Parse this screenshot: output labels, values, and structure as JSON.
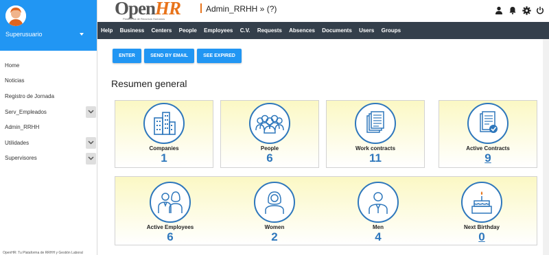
{
  "user": {
    "name": "Superusuario"
  },
  "sidebar": {
    "items": [
      {
        "label": "Home",
        "expandable": false
      },
      {
        "label": "Noticias",
        "expandable": false
      },
      {
        "label": "Registro de Jornada",
        "expandable": false
      },
      {
        "label": "Serv_Empleados",
        "expandable": true
      },
      {
        "label": "Admin_RRHH",
        "expandable": false
      },
      {
        "label": "Utilidades",
        "expandable": true
      },
      {
        "label": "Supervisores",
        "expandable": true
      }
    ],
    "footer": "OpenHR: Tu Plataforma de RRHH y Gestión Laboral"
  },
  "brand": {
    "open": "Open",
    "hr": "HR",
    "subtitle": "Plataforma de Recursos Humanos"
  },
  "header": {
    "breadcrumb": "Admin_RRHH » (?)"
  },
  "top_icons": [
    "user-icon",
    "bell-icon",
    "gear-icon",
    "power-icon"
  ],
  "nav": [
    "Help",
    "Business",
    "Centers",
    "People",
    "Employees",
    "C.V.",
    "Requests",
    "Absences",
    "Documents",
    "Users",
    "Groups"
  ],
  "buttons": {
    "enter": "ENTER",
    "send_email": "SEND BY EMAIL",
    "see_expired": "SEE EXPIRED"
  },
  "section_title": "Resumen general",
  "tiles": [
    {
      "label": "Companies",
      "value": "1",
      "icon": "building-icon",
      "link": false
    },
    {
      "label": "People",
      "value": "6",
      "icon": "people-group-icon",
      "link": false
    },
    {
      "label": "Work contracts",
      "value": "11",
      "icon": "documents-icon",
      "link": false
    },
    {
      "label": "Active Contracts",
      "value": "9",
      "icon": "contract-check-icon",
      "link": true
    },
    {
      "label": "Active Employees",
      "value": "6",
      "icon": "couple-icon",
      "link": false
    },
    {
      "label": "Women",
      "value": "2",
      "icon": "woman-icon",
      "link": false
    },
    {
      "label": "Men",
      "value": "4",
      "icon": "man-icon",
      "link": false
    },
    {
      "label": "Next Birthday",
      "value": "0",
      "icon": "birthday-cake-icon",
      "link": true
    }
  ],
  "colors": {
    "accent": "#2196f3",
    "navbar": "#343f4b",
    "icon_blue": "#2e77bc",
    "brand_orange": "#e8731a",
    "card_bg": "#fbf8c4"
  }
}
